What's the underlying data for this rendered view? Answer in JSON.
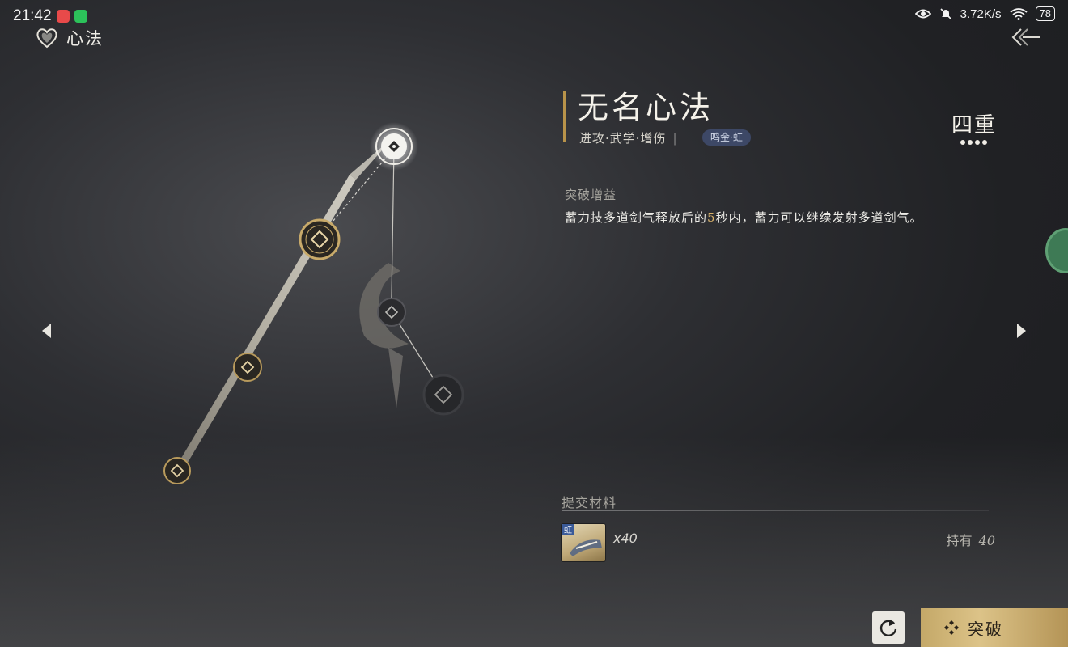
{
  "status_bar": {
    "time": "21:42",
    "network_speed": "3.72K/s",
    "battery": "78"
  },
  "header": {
    "title": "心法"
  },
  "skill": {
    "name": "无名心法",
    "tags": "进攻·武学·增伤",
    "badge": "鸣金·虹",
    "rank": "四重"
  },
  "breakthrough": {
    "section_label": "突破增益",
    "desc_before": "蓄力技多道剑气释放后的",
    "desc_number": "5",
    "desc_after": "秒内，蓄力可以继续发射多道剑气。"
  },
  "materials": {
    "label": "提交材料",
    "item_tag": "虹",
    "quantity": "x40",
    "owned_label": "持有",
    "owned_value": "40"
  },
  "actions": {
    "breakthrough_label": "突破"
  },
  "colors": {
    "accent_gold": "#b8934a",
    "badge_blue": "#3d4866",
    "button_gold": "#dcc388"
  }
}
